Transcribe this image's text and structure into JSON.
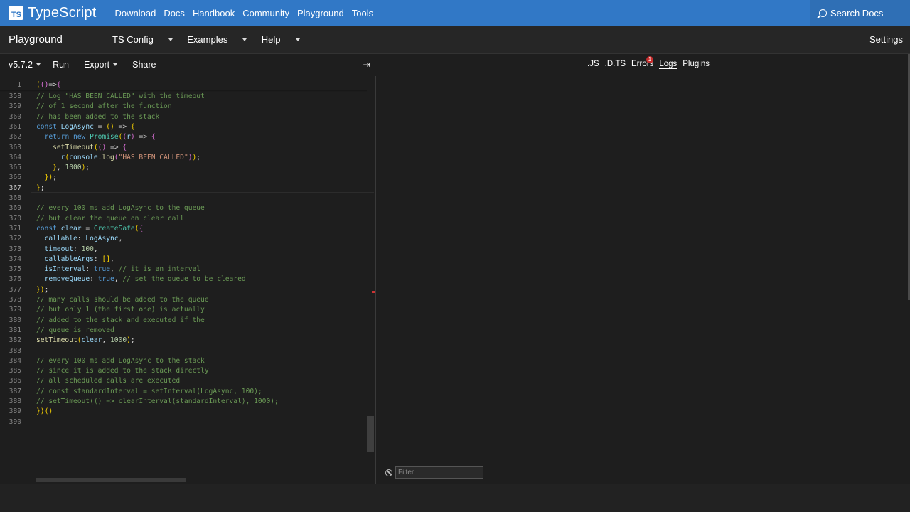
{
  "brand": {
    "logo_text": "TS",
    "name": "TypeScript"
  },
  "nav": {
    "links": [
      "Download",
      "Docs",
      "Handbook",
      "Community",
      "Playground",
      "Tools"
    ],
    "search_label": "Search Docs"
  },
  "playground_bar": {
    "title": "Playground",
    "menus": [
      "TS Config",
      "Examples",
      "Help"
    ],
    "settings": "Settings"
  },
  "editor_toolbar": {
    "version": "v5.7.2",
    "run": "Run",
    "export": "Export",
    "share": "Share",
    "collapse_glyph": "⇥"
  },
  "editor": {
    "sticky_line": 1,
    "active_line": 367,
    "lines": [
      {
        "n": 358,
        "t": "// Log \"HAS BEEN CALLED\" with the timeout"
      },
      {
        "n": 359,
        "t": "// of 1 second after the function"
      },
      {
        "n": 360,
        "t": "// has been added to the stack"
      },
      {
        "n": 361,
        "t": "const LogAsync = () => {"
      },
      {
        "n": 362,
        "t": "  return new Promise((r) => {"
      },
      {
        "n": 363,
        "t": "    setTimeout(() => {"
      },
      {
        "n": 364,
        "t": "      r(console.log(\"HAS BEEN CALLED\"));"
      },
      {
        "n": 365,
        "t": "    }, 1000);"
      },
      {
        "n": 366,
        "t": "  });"
      },
      {
        "n": 367,
        "t": "};"
      },
      {
        "n": 368,
        "t": ""
      },
      {
        "n": 369,
        "t": "// every 100 ms add LogAsync to the queue"
      },
      {
        "n": 370,
        "t": "// but clear the queue on clear call"
      },
      {
        "n": 371,
        "t": "const clear = CreateSafe({"
      },
      {
        "n": 372,
        "t": "  callable: LogAsync,"
      },
      {
        "n": 373,
        "t": "  timeout: 100,"
      },
      {
        "n": 374,
        "t": "  callableArgs: [],"
      },
      {
        "n": 375,
        "t": "  isInterval: true, // it is an interval"
      },
      {
        "n": 376,
        "t": "  removeQueue: true, // set the queue to be cleared"
      },
      {
        "n": 377,
        "t": "});"
      },
      {
        "n": 378,
        "t": "// many calls should be added to the queue"
      },
      {
        "n": 379,
        "t": "// but only 1 (the first one) is actually"
      },
      {
        "n": 380,
        "t": "// added to the stack and executed if the"
      },
      {
        "n": 381,
        "t": "// queue is removed"
      },
      {
        "n": 382,
        "t": "setTimeout(clear, 1000);"
      },
      {
        "n": 383,
        "t": ""
      },
      {
        "n": 384,
        "t": "// every 100 ms add LogAsync to the stack"
      },
      {
        "n": 385,
        "t": "// since it is added to the stack directly"
      },
      {
        "n": 386,
        "t": "// all scheduled calls are executed"
      },
      {
        "n": 387,
        "t": "// const standardInterval = setInterval(LogAsync, 100);"
      },
      {
        "n": 388,
        "t": "// setTimeout(() => clearInterval(standardInterval), 1000);"
      },
      {
        "n": 389,
        "t": "})()"
      },
      {
        "n": 390,
        "t": ""
      }
    ],
    "sticky_text": "(()=>{"
  },
  "output_panel": {
    "tabs": [
      ".JS",
      ".D.TS",
      "Errors",
      "Logs",
      "Plugins"
    ],
    "active_tab": "Logs",
    "errors_badge": "1",
    "filter_placeholder": "Filter"
  },
  "colors": {
    "brand_blue": "#3178c6",
    "background": "#1e1e1e",
    "comment": "#6a9955",
    "keyword": "#569cd6",
    "badge": "#c72c2c"
  }
}
